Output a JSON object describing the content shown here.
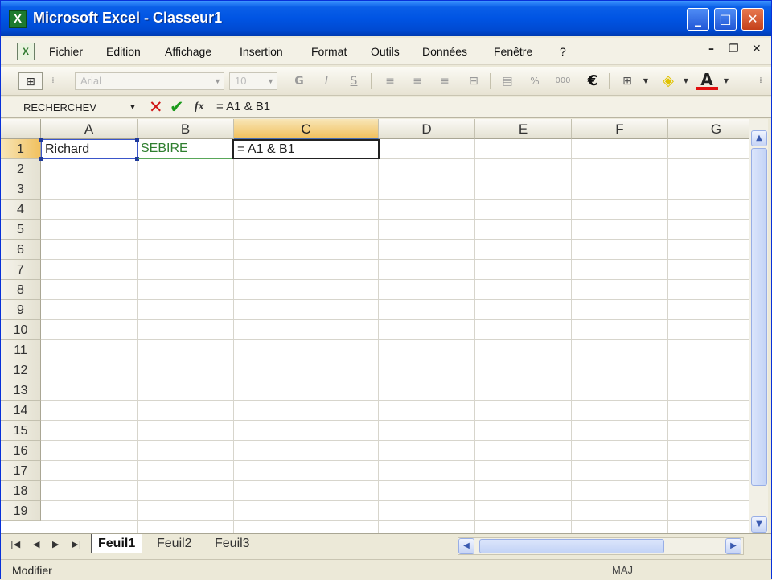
{
  "window": {
    "title": "Microsoft Excel - Classeur1",
    "app_icon": "X"
  },
  "titlebar_buttons": {
    "minimize": "_",
    "maximize": "□",
    "close": "✕"
  },
  "menu": {
    "items": [
      "Fichier",
      "Edition",
      "Affichage",
      "Insertion",
      "Format",
      "Outils",
      "Données",
      "Fenêtre",
      "?"
    ],
    "mdi_minimize": "–",
    "mdi_restore": "❐",
    "mdi_close": "✕"
  },
  "toolbar": {
    "font_name": "Arial",
    "font_size": "10",
    "bold": "G",
    "italic": "I",
    "underline": "S",
    "euro": "€",
    "percent": "%",
    "currency_sep": "000"
  },
  "formula_bar": {
    "name_box": "RECHERCHEV",
    "cancel": "✕",
    "enter": "✔",
    "fx": "fx",
    "formula": "= A1 & B1"
  },
  "grid": {
    "columns": [
      "A",
      "B",
      "C",
      "D",
      "E",
      "F",
      "G"
    ],
    "rows": [
      "1",
      "2",
      "3",
      "4",
      "5",
      "6",
      "7",
      "8",
      "9",
      "10",
      "11",
      "12",
      "13",
      "14",
      "15",
      "16",
      "17",
      "18",
      "19"
    ],
    "cells": {
      "A1": "Richard",
      "B1": "SEBIRE",
      "C1": "= A1 & B1"
    }
  },
  "sheets": {
    "tabs": [
      "Feuil1",
      "Feuil2",
      "Feuil3"
    ],
    "active": "Feuil1",
    "nav": [
      "|◀",
      "◀",
      "▶",
      "▶|"
    ]
  },
  "scroll": {
    "up": "▲",
    "down": "▼",
    "left": "◀",
    "right": "▶"
  },
  "status": {
    "mode": "Modifier",
    "indicator": "MAJ"
  },
  "colors": {
    "title_bar": "#0054e3",
    "selected_header": "#f1c15f",
    "ref_a1": "#3a55c9",
    "ref_b1": "#2f7f2f"
  }
}
